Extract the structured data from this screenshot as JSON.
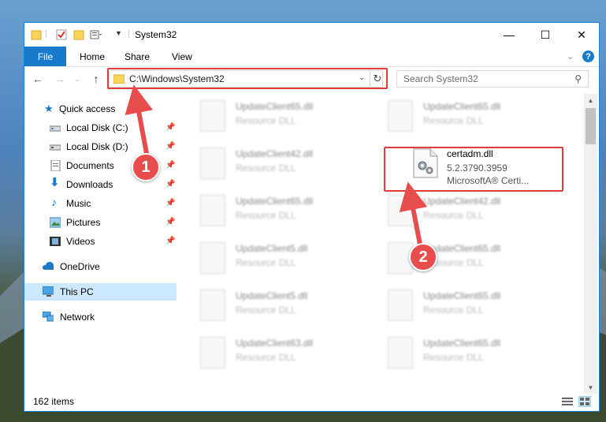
{
  "window": {
    "title": "System32",
    "controls": {
      "minimize": "—",
      "maximize": "☐",
      "close": "✕"
    }
  },
  "ribbon": {
    "tabs": [
      {
        "label": "File",
        "active": true
      },
      {
        "label": "Home"
      },
      {
        "label": "Share"
      },
      {
        "label": "View"
      }
    ],
    "expand_icon": "chevron-down-icon",
    "help_icon": "help-icon"
  },
  "navigation": {
    "address": "C:\\Windows\\System32",
    "search_placeholder": "Search System32"
  },
  "sidebar": {
    "items": [
      {
        "label": "Quick access",
        "icon": "star-icon",
        "pinned": false
      },
      {
        "label": "Local Disk (C:)",
        "icon": "drive-icon",
        "pinned": true
      },
      {
        "label": "Local Disk (D:)",
        "icon": "drive-icon",
        "pinned": true
      },
      {
        "label": "Documents",
        "icon": "document-icon",
        "pinned": true
      },
      {
        "label": "Downloads",
        "icon": "download-icon",
        "pinned": true
      },
      {
        "label": "Music",
        "icon": "music-icon",
        "pinned": true
      },
      {
        "label": "Pictures",
        "icon": "pictures-icon",
        "pinned": true
      },
      {
        "label": "Videos",
        "icon": "video-icon",
        "pinned": true
      },
      {
        "label": "OneDrive",
        "icon": "cloud-icon",
        "pinned": false
      },
      {
        "label": "This PC",
        "icon": "computer-icon",
        "pinned": false,
        "selected": true
      },
      {
        "label": "Network",
        "icon": "network-icon",
        "pinned": false
      }
    ]
  },
  "files": [
    {
      "name": "UpdateClient65.dll",
      "type": "Resource DLL"
    },
    {
      "name": "UpdateClient65.dll",
      "type": "Resource DLL"
    },
    {
      "name": "UpdateClient42.dll",
      "type": "Resource DLL"
    },
    {
      "name": "certadm.dll",
      "version": "5.2.3790.3959",
      "company": "MicrosoftA® Certi...",
      "highlighted": true
    },
    {
      "name": "UpdateClient65.dll",
      "type": "Resource DLL"
    },
    {
      "name": "UpdateClient42.dll",
      "type": "Resource DLL"
    },
    {
      "name": "UpdateClient5.dll",
      "type": "Resource DLL"
    },
    {
      "name": "UpdateClient65.dll",
      "type": "Resource DLL"
    },
    {
      "name": "UpdateClient5.dll",
      "type": "Resource DLL"
    },
    {
      "name": "UpdateClient65.dll",
      "type": "Resource DLL"
    },
    {
      "name": "UpdateClient63.dll",
      "type": "Resource DLL"
    },
    {
      "name": "UpdateClient65.dll",
      "type": "Resource DLL"
    }
  ],
  "status": {
    "item_count": "162 items"
  },
  "callouts": [
    {
      "number": "1"
    },
    {
      "number": "2"
    }
  ],
  "colors": {
    "accent": "#1979ca",
    "highlight": "#e03c3c",
    "selected": "#cce8ff"
  }
}
